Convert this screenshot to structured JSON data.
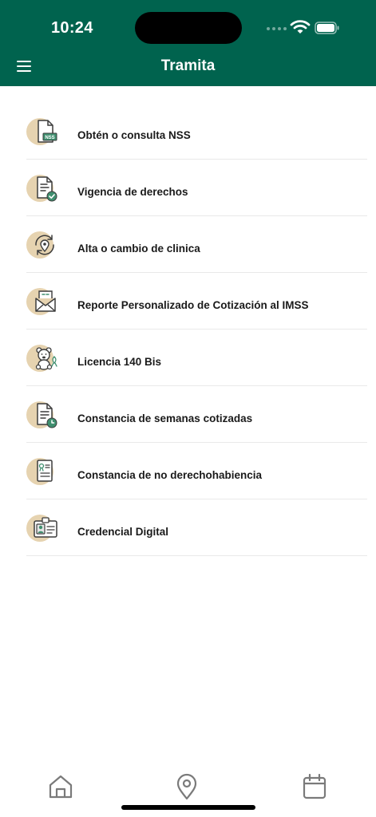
{
  "status_bar": {
    "time": "10:24"
  },
  "nav": {
    "title": "Tramita",
    "menu_icon": "hamburger-menu-icon"
  },
  "theme": {
    "primary": "#00634e",
    "icon_bg": "#e6d3b0",
    "icon_stroke": "#3c3c3c",
    "icon_accent": "#3f8f6f"
  },
  "menu_items": [
    {
      "label": "Obtén o consulta NSS",
      "icon": "nss-document-icon"
    },
    {
      "label": "Vigencia de derechos",
      "icon": "verified-document-icon"
    },
    {
      "label": "Alta o cambio de clinica",
      "icon": "location-refresh-icon"
    },
    {
      "label": "Reporte Personalizado de Cotización al IMSS",
      "icon": "envelope-report-icon"
    },
    {
      "label": "Licencia 140 Bis",
      "icon": "teddy-bear-ribbon-icon"
    },
    {
      "label": "Constancia de semanas cotizadas",
      "icon": "document-clock-icon"
    },
    {
      "label": "Constancia de no derechohabiencia",
      "icon": "clipboard-certificate-icon"
    },
    {
      "label": "Credencial Digital",
      "icon": "id-card-icon"
    }
  ],
  "tabbar": {
    "tabs": [
      {
        "name": "home",
        "icon": "home-icon"
      },
      {
        "name": "location",
        "icon": "location-pin-icon"
      },
      {
        "name": "calendar",
        "icon": "calendar-icon"
      }
    ]
  }
}
